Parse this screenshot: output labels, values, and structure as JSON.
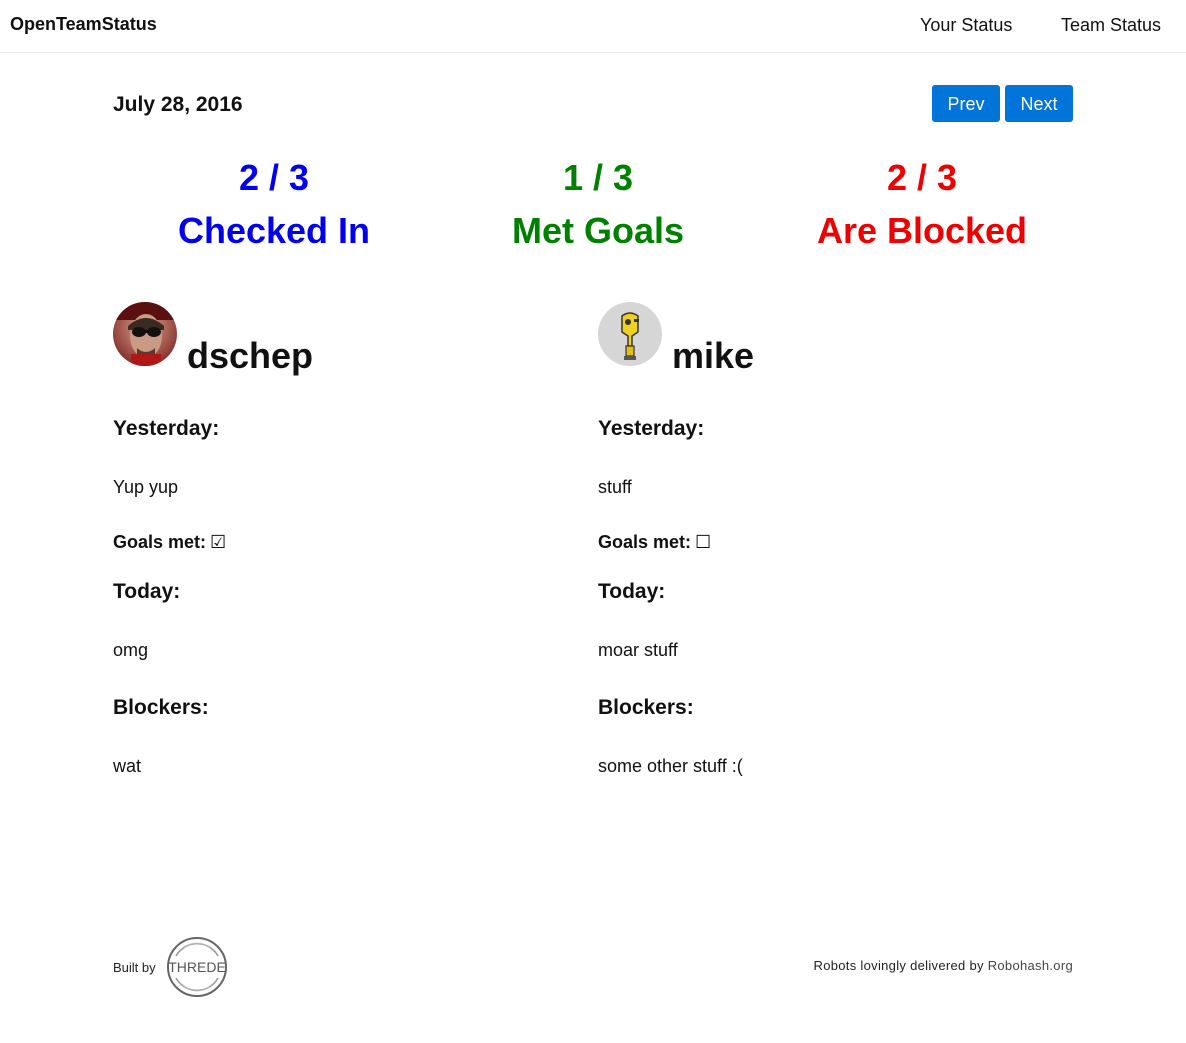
{
  "nav": {
    "brand": "OpenTeamStatus",
    "links": [
      "Your Status",
      "Team Status"
    ]
  },
  "date": "July 28, 2016",
  "pager": {
    "prev": "Prev",
    "next": "Next"
  },
  "stats": [
    {
      "value": "2 / 3",
      "label": "Checked In",
      "color": "#0000ee"
    },
    {
      "value": "1 / 3",
      "label": "Met Goals",
      "color": "#008000"
    },
    {
      "value": "2 / 3",
      "label": "Are Blocked",
      "color": "#ee0000"
    }
  ],
  "people": [
    {
      "username": "dschep",
      "avatar_icon": "user-photo-avatar",
      "yesterday_label": "Yesterday:",
      "yesterday": "Yup yup",
      "goals_label": "Goals met:",
      "goals_mark": "☑",
      "today_label": "Today:",
      "today": "omg",
      "blockers_label": "Blockers:",
      "blockers": "wat"
    },
    {
      "username": "mike",
      "avatar_icon": "robot-avatar",
      "yesterday_label": "Yesterday:",
      "yesterday": "stuff",
      "goals_label": "Goals met:",
      "goals_mark": "☐",
      "today_label": "Today:",
      "today": "moar stuff",
      "blockers_label": "Blockers:",
      "blockers": "some other stuff :("
    }
  ],
  "footer": {
    "built_by": "Built by",
    "logo_text": "THREDE",
    "robots_text": "Robots lovingly delivered by",
    "robots_link": "Robohash.org"
  }
}
